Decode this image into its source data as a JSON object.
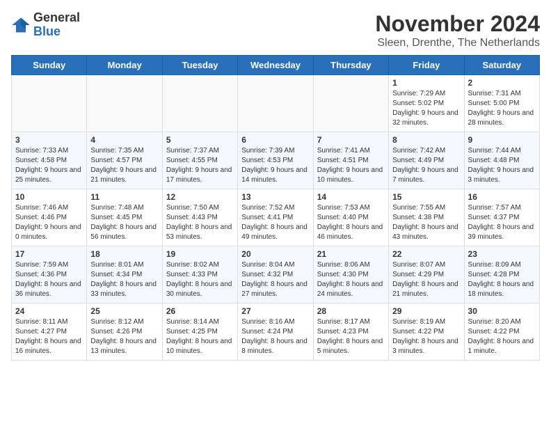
{
  "logo": {
    "general": "General",
    "blue": "Blue"
  },
  "header": {
    "month": "November 2024",
    "location": "Sleen, Drenthe, The Netherlands"
  },
  "weekdays": [
    "Sunday",
    "Monday",
    "Tuesday",
    "Wednesday",
    "Thursday",
    "Friday",
    "Saturday"
  ],
  "weeks": [
    [
      {
        "day": "",
        "info": ""
      },
      {
        "day": "",
        "info": ""
      },
      {
        "day": "",
        "info": ""
      },
      {
        "day": "",
        "info": ""
      },
      {
        "day": "",
        "info": ""
      },
      {
        "day": "1",
        "info": "Sunrise: 7:29 AM\nSunset: 5:02 PM\nDaylight: 9 hours and 32 minutes."
      },
      {
        "day": "2",
        "info": "Sunrise: 7:31 AM\nSunset: 5:00 PM\nDaylight: 9 hours and 28 minutes."
      }
    ],
    [
      {
        "day": "3",
        "info": "Sunrise: 7:33 AM\nSunset: 4:58 PM\nDaylight: 9 hours and 25 minutes."
      },
      {
        "day": "4",
        "info": "Sunrise: 7:35 AM\nSunset: 4:57 PM\nDaylight: 9 hours and 21 minutes."
      },
      {
        "day": "5",
        "info": "Sunrise: 7:37 AM\nSunset: 4:55 PM\nDaylight: 9 hours and 17 minutes."
      },
      {
        "day": "6",
        "info": "Sunrise: 7:39 AM\nSunset: 4:53 PM\nDaylight: 9 hours and 14 minutes."
      },
      {
        "day": "7",
        "info": "Sunrise: 7:41 AM\nSunset: 4:51 PM\nDaylight: 9 hours and 10 minutes."
      },
      {
        "day": "8",
        "info": "Sunrise: 7:42 AM\nSunset: 4:49 PM\nDaylight: 9 hours and 7 minutes."
      },
      {
        "day": "9",
        "info": "Sunrise: 7:44 AM\nSunset: 4:48 PM\nDaylight: 9 hours and 3 minutes."
      }
    ],
    [
      {
        "day": "10",
        "info": "Sunrise: 7:46 AM\nSunset: 4:46 PM\nDaylight: 9 hours and 0 minutes."
      },
      {
        "day": "11",
        "info": "Sunrise: 7:48 AM\nSunset: 4:45 PM\nDaylight: 8 hours and 56 minutes."
      },
      {
        "day": "12",
        "info": "Sunrise: 7:50 AM\nSunset: 4:43 PM\nDaylight: 8 hours and 53 minutes."
      },
      {
        "day": "13",
        "info": "Sunrise: 7:52 AM\nSunset: 4:41 PM\nDaylight: 8 hours and 49 minutes."
      },
      {
        "day": "14",
        "info": "Sunrise: 7:53 AM\nSunset: 4:40 PM\nDaylight: 8 hours and 46 minutes."
      },
      {
        "day": "15",
        "info": "Sunrise: 7:55 AM\nSunset: 4:38 PM\nDaylight: 8 hours and 43 minutes."
      },
      {
        "day": "16",
        "info": "Sunrise: 7:57 AM\nSunset: 4:37 PM\nDaylight: 8 hours and 39 minutes."
      }
    ],
    [
      {
        "day": "17",
        "info": "Sunrise: 7:59 AM\nSunset: 4:36 PM\nDaylight: 8 hours and 36 minutes."
      },
      {
        "day": "18",
        "info": "Sunrise: 8:01 AM\nSunset: 4:34 PM\nDaylight: 8 hours and 33 minutes."
      },
      {
        "day": "19",
        "info": "Sunrise: 8:02 AM\nSunset: 4:33 PM\nDaylight: 8 hours and 30 minutes."
      },
      {
        "day": "20",
        "info": "Sunrise: 8:04 AM\nSunset: 4:32 PM\nDaylight: 8 hours and 27 minutes."
      },
      {
        "day": "21",
        "info": "Sunrise: 8:06 AM\nSunset: 4:30 PM\nDaylight: 8 hours and 24 minutes."
      },
      {
        "day": "22",
        "info": "Sunrise: 8:07 AM\nSunset: 4:29 PM\nDaylight: 8 hours and 21 minutes."
      },
      {
        "day": "23",
        "info": "Sunrise: 8:09 AM\nSunset: 4:28 PM\nDaylight: 8 hours and 18 minutes."
      }
    ],
    [
      {
        "day": "24",
        "info": "Sunrise: 8:11 AM\nSunset: 4:27 PM\nDaylight: 8 hours and 16 minutes."
      },
      {
        "day": "25",
        "info": "Sunrise: 8:12 AM\nSunset: 4:26 PM\nDaylight: 8 hours and 13 minutes."
      },
      {
        "day": "26",
        "info": "Sunrise: 8:14 AM\nSunset: 4:25 PM\nDaylight: 8 hours and 10 minutes."
      },
      {
        "day": "27",
        "info": "Sunrise: 8:16 AM\nSunset: 4:24 PM\nDaylight: 8 hours and 8 minutes."
      },
      {
        "day": "28",
        "info": "Sunrise: 8:17 AM\nSunset: 4:23 PM\nDaylight: 8 hours and 5 minutes."
      },
      {
        "day": "29",
        "info": "Sunrise: 8:19 AM\nSunset: 4:22 PM\nDaylight: 8 hours and 3 minutes."
      },
      {
        "day": "30",
        "info": "Sunrise: 8:20 AM\nSunset: 4:22 PM\nDaylight: 8 hours and 1 minute."
      }
    ]
  ]
}
